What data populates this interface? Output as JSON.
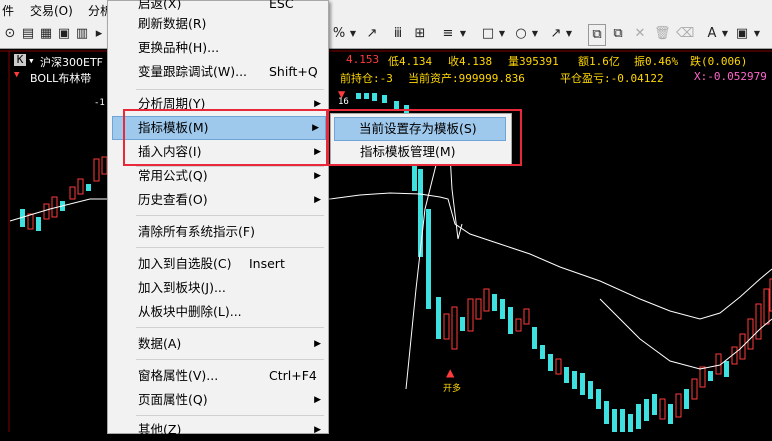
{
  "menubar": {
    "items": [
      "件",
      "交易(O)",
      "分析"
    ]
  },
  "toolbar": {
    "percent": "%",
    "line_label": "≡",
    "rect": "□",
    "circle": "○",
    "pen": "↗",
    "text": "A",
    "delete": "✕"
  },
  "chart": {
    "symbol": "沪深300ETF",
    "k_label": "K",
    "indicator": "BOLL布林带",
    "price_peak": "4.153",
    "low_label": "低4.134",
    "close_label": "收4.138",
    "volume_label": "量395391",
    "amount_label": "额1.6亿",
    "amplitude_label": "振0.46%",
    "change_label": "跌(0.006)",
    "position_label": "前持仓:-3",
    "assets_label": "当前资产:999999.836",
    "pnl_label": "平仓盈亏:-0.04122",
    "x_label": "X:-0.052979",
    "buy_signal": "开多",
    "small_label": "16",
    "left_label": "-1",
    "colors": {
      "up": "#ff3b3b",
      "down": "#3fe0e0",
      "mid": "#ffffff",
      "bg": "#000000",
      "yellow": "#ffd700",
      "pink": "#ff66cc"
    }
  },
  "context_menu": {
    "items": [
      {
        "label": "启返(X)",
        "shortcut": "ESC"
      },
      {
        "label": "刷新数据(R)",
        "shortcut": ""
      },
      {
        "label": "更换品种(H)...",
        "shortcut": ""
      },
      {
        "label": "变量跟踪调试(W)...",
        "shortcut": "Shift+Q"
      },
      {
        "label": "分析周期(Y)",
        "shortcut": "",
        "submenu": true
      },
      {
        "label": "指标模板(M)",
        "shortcut": "",
        "submenu": true,
        "highlighted": true
      },
      {
        "label": "插入内容(I)",
        "shortcut": "",
        "submenu": true
      },
      {
        "label": "常用公式(Q)",
        "shortcut": "",
        "submenu": true
      },
      {
        "label": "历史查看(O)",
        "shortcut": "",
        "submenu": true
      },
      {
        "label": "清除所有系统指示(F)",
        "shortcut": ""
      },
      {
        "label": "加入到自选股(C)",
        "shortcut": "Insert"
      },
      {
        "label": "加入到板块(J)...",
        "shortcut": ""
      },
      {
        "label": "从板块中删除(L)...",
        "shortcut": ""
      },
      {
        "label": "数据(A)",
        "shortcut": "",
        "submenu": true
      },
      {
        "label": "窗格属性(V)...",
        "shortcut": "Ctrl+F4"
      },
      {
        "label": "页面属性(Q)",
        "shortcut": "",
        "submenu": true
      },
      {
        "label": "其他(Z)",
        "shortcut": "",
        "submenu": true
      }
    ]
  },
  "submenu": {
    "items": [
      {
        "label": "当前设置存为模板(S)",
        "highlighted": true
      },
      {
        "label": "指标模板管理(M)"
      }
    ]
  }
}
